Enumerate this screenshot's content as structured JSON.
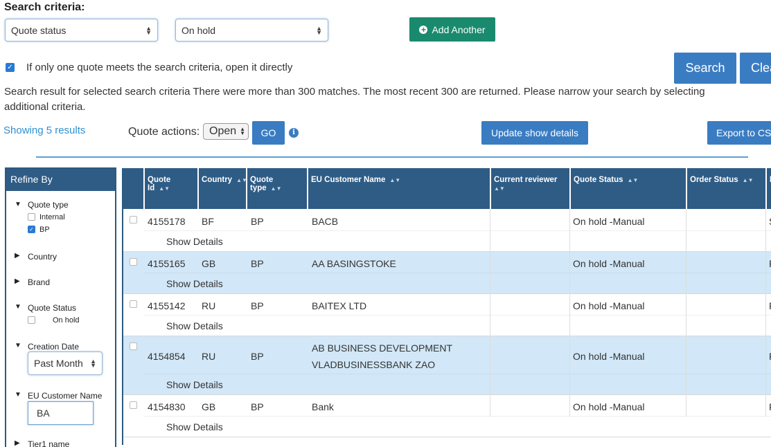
{
  "search": {
    "title": "Search criteria:",
    "field_select": "Quote status",
    "value_select": "On hold",
    "add_another": "Add Another",
    "open_directly_label": "If only one quote meets the search criteria, open it directly",
    "search_button": "Search",
    "clear_button": "Clea",
    "result_message": "Search result for selected search criteria There were more than 300 matches. The most recent 300 are returned. Please narrow your search by selecting",
    "result_message_2": "additional criteria."
  },
  "actions": {
    "showing": "Showing 5 results",
    "quote_actions_label": "Quote actions:",
    "quote_action_value": "Open",
    "go_button": "GO",
    "info_icon": "i",
    "update_button": "Update show details",
    "export_button": "Export to CS"
  },
  "refine": {
    "title": "Refine By",
    "quote_type": "Quote type",
    "internal": "Internal",
    "bp": "BP",
    "country": "Country",
    "brand": "Brand",
    "quote_status": "Quote Status",
    "on_hold": "On hold",
    "creation_date": "Creation Date",
    "creation_value": "Past Month",
    "eu_customer": "EU Customer Name",
    "eu_customer_value": "BA",
    "tier1": "Tier1 name"
  },
  "table": {
    "headers": [
      "Quote Id",
      "Country",
      "Quote type",
      "EU Customer Name",
      "Current reviewer",
      "Quote Status",
      "Order Status",
      "E"
    ],
    "show_details": "Show Details",
    "rows": [
      {
        "id": "4155178",
        "country": "BF",
        "type": "BP",
        "customer": "BACB",
        "customer2": "",
        "status": "On hold -Manual",
        "last": "S"
      },
      {
        "id": "4155165",
        "country": "GB",
        "type": "BP",
        "customer": "AA BASINGSTOKE",
        "customer2": "",
        "status": "On hold -Manual",
        "last": "F"
      },
      {
        "id": "4155142",
        "country": "RU",
        "type": "BP",
        "customer": "BAITEX LTD",
        "customer2": "",
        "status": "On hold -Manual",
        "last": "F"
      },
      {
        "id": "4154854",
        "country": "RU",
        "type": "BP",
        "customer": "AB BUSINESS DEVELOPMENT",
        "customer2": "VLADBUSINESSBANK ZAO",
        "status": "On hold -Manual",
        "last": "F"
      },
      {
        "id": "4154830",
        "country": "GB",
        "type": "BP",
        "customer": "Bank",
        "customer2": "",
        "status": "On hold -Manual",
        "last": "F"
      }
    ]
  }
}
